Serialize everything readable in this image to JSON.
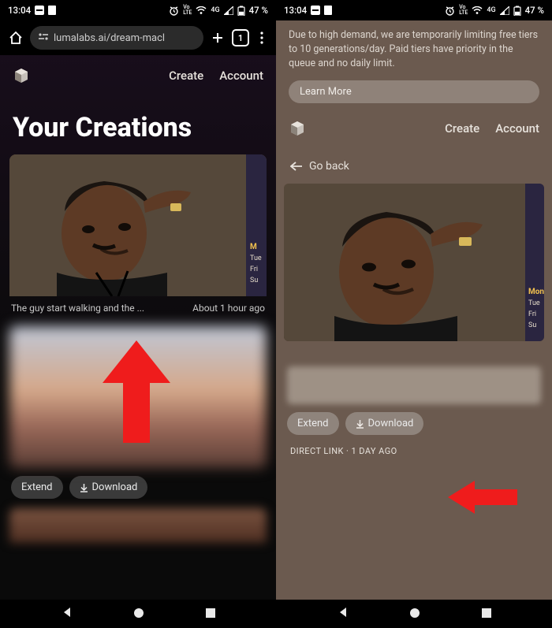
{
  "status": {
    "time": "13:04",
    "network": "4G",
    "battery": "47 %"
  },
  "chrome": {
    "url": "lumalabs.ai/dream-macl",
    "tab_count": "1"
  },
  "left": {
    "nav": {
      "create": "Create",
      "account": "Account"
    },
    "title": "Your Creations",
    "card1": {
      "caption": "The guy start walking and the ...",
      "time": "About 1 hour ago"
    },
    "buttons": {
      "extend": "Extend",
      "download": "Download"
    }
  },
  "right": {
    "notice": "Due to high demand, we are temporarily limiting free tiers to 10 generations/day. Paid tiers have priority in the queue and no daily limit.",
    "learn_more": "Learn More",
    "nav": {
      "create": "Create",
      "account": "Account"
    },
    "go_back": "Go back",
    "buttons": {
      "extend": "Extend",
      "download": "Download"
    },
    "meta": "DIRECT LINK · 1 DAY AGO"
  },
  "side_labels": {
    "mon": "Mon",
    "tue": "Tue",
    "fri": "Fri",
    "su": "Su"
  }
}
